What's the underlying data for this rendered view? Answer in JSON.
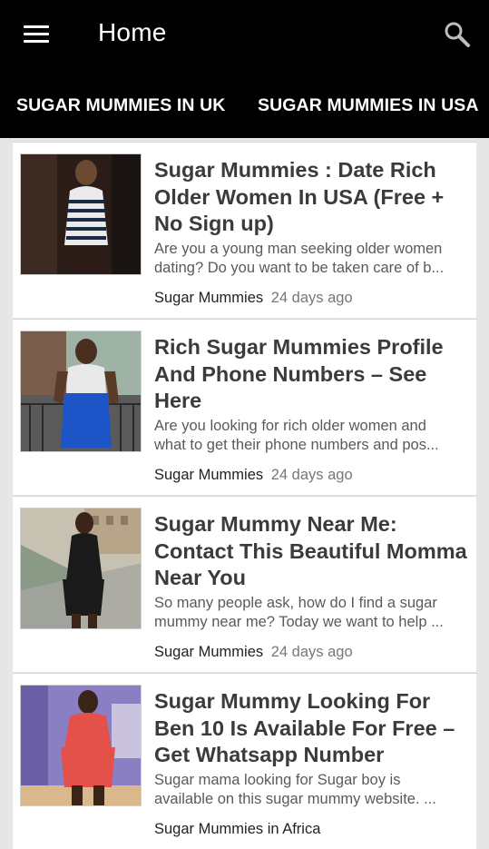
{
  "appbar": {
    "title": "Home",
    "menu_icon": "hamburger-menu-icon",
    "search_icon": "search-icon"
  },
  "tabs": [
    {
      "label": "SUGAR MUMMIES IN UK"
    },
    {
      "label": "SUGAR MUMMIES IN USA"
    }
  ],
  "posts": [
    {
      "title": "Sugar Mummies : Date Rich Older Women In USA (Free + No Sign up)",
      "excerpt_1": "Are you a young man seeking older women",
      "excerpt_2": "dating? Do you want to be taken care of b...",
      "category": "Sugar Mummies",
      "time": "24 days ago"
    },
    {
      "title": "Rich Sugar Mummies Profile And Phone Numbers – See Here",
      "excerpt_1": "Are you looking for rich older women and",
      "excerpt_2": "what to get their phone numbers and pos...",
      "category": "Sugar Mummies",
      "time": "24 days ago"
    },
    {
      "title": "Sugar Mummy Near Me: Contact This Beautiful Momma Near You",
      "excerpt_1": "So many people ask, how do I find a sugar",
      "excerpt_2": "mummy near me? Today we want to help ...",
      "category": "Sugar Mummies",
      "time": "24 days ago"
    },
    {
      "title": "Sugar Mummy Looking For Ben 10 Is Available For Free – Get Whatsapp Number",
      "excerpt_1": "Sugar mama looking for Sugar boy is",
      "excerpt_2": "available on this sugar mummy website. ...",
      "category": "Sugar Mummies in Africa",
      "time": ""
    }
  ],
  "colors": {
    "appbar_bg": "#000000",
    "page_bg": "#e6e6e6",
    "card_bg": "#ffffff",
    "title_text": "#3b3b3b"
  }
}
